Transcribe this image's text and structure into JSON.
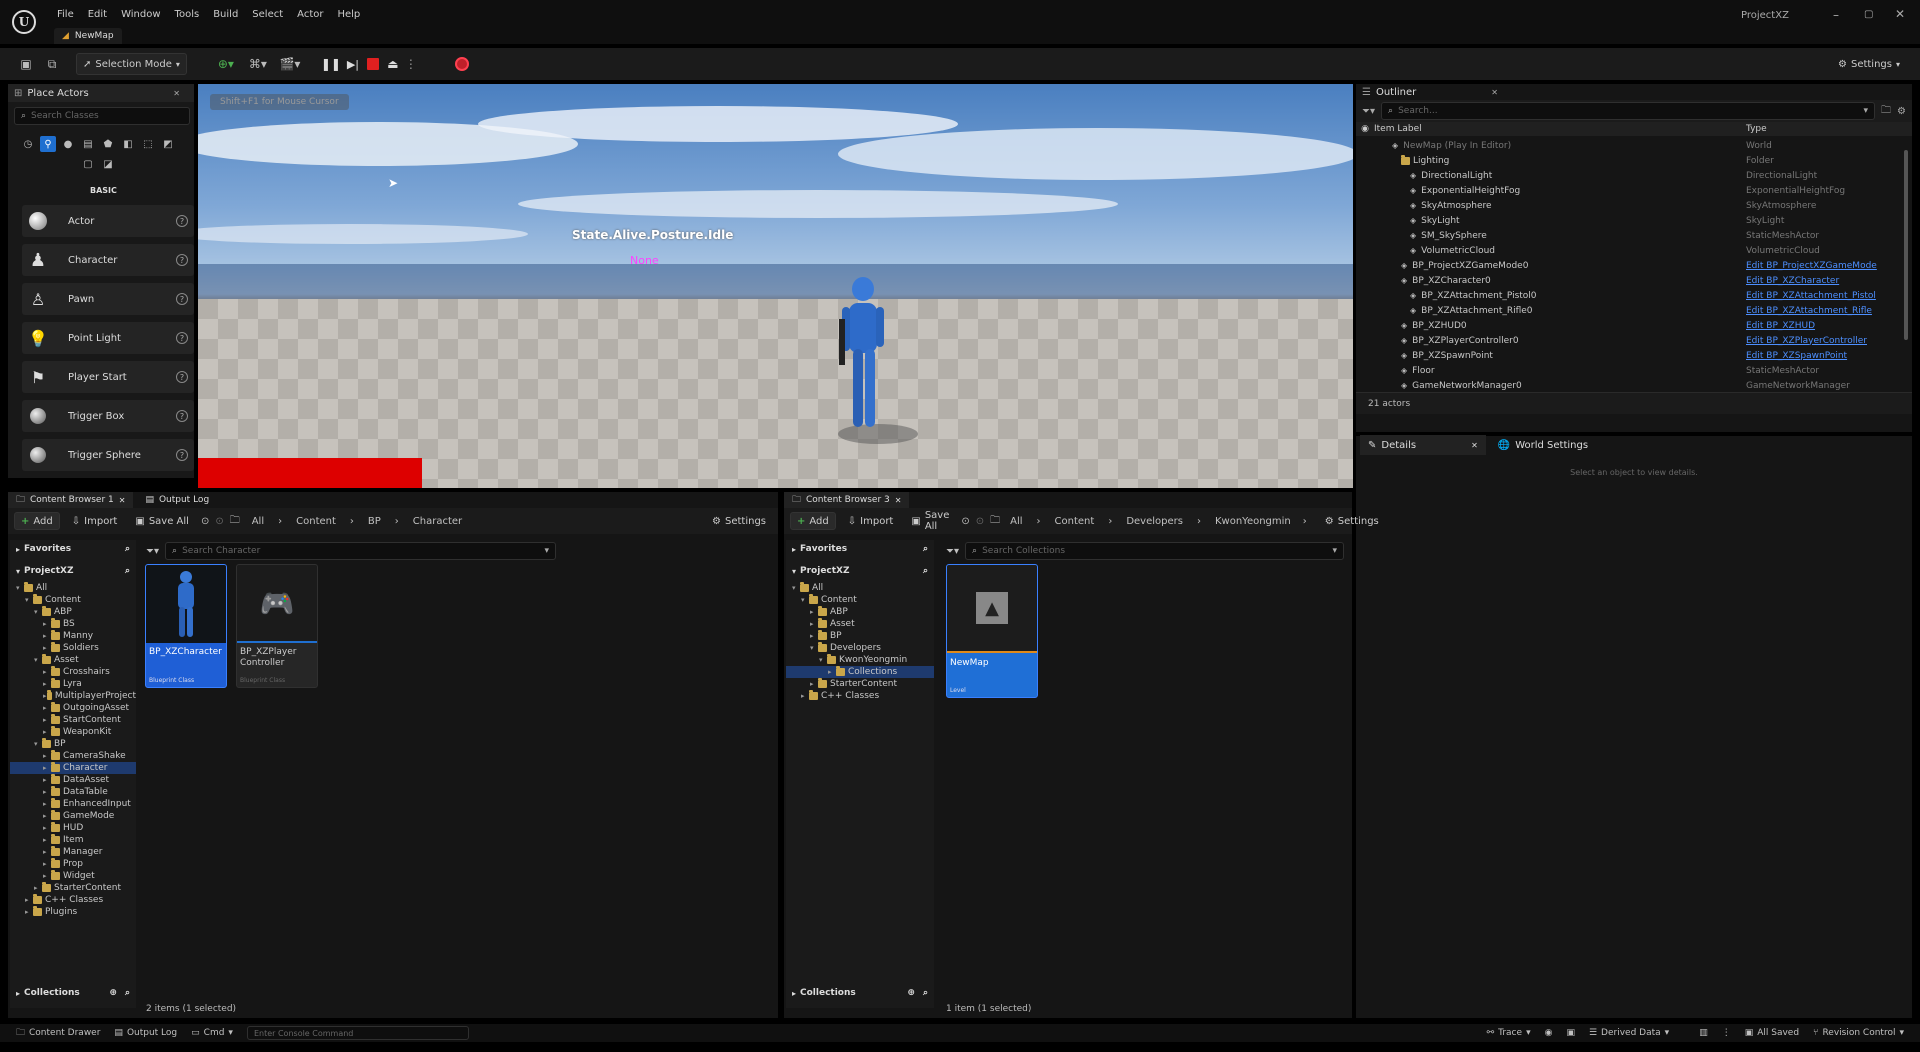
{
  "menu": {
    "items": [
      "File",
      "Edit",
      "Window",
      "Tools",
      "Build",
      "Select",
      "Actor",
      "Help"
    ],
    "project_name": "ProjectXZ",
    "map_tab": "NewMap"
  },
  "toolbar": {
    "selection_mode": "Selection Mode",
    "settings": "Settings"
  },
  "place_actors": {
    "title": "Place Actors",
    "search_placeholder": "Search Classes",
    "section": "BASIC",
    "items": [
      "Actor",
      "Character",
      "Pawn",
      "Point Light",
      "Player Start",
      "Trigger Box",
      "Trigger Sphere"
    ]
  },
  "viewport": {
    "banner": "Shift+F1 for Mouse Cursor",
    "state_text": "State.Alive.Posture.Idle",
    "none_text": "None",
    "colors": {
      "state": "#ffffff",
      "none": "#ff40ff",
      "health_bar": "#dd0000"
    }
  },
  "outliner": {
    "title": "Outliner",
    "search_placeholder": "Search...",
    "col_label": "Item Label",
    "col_type": "Type",
    "rows": [
      {
        "label": "NewMap (Play In Editor)",
        "type": "World",
        "indent": 2,
        "dim": true,
        "link": false
      },
      {
        "label": "Lighting",
        "type": "Folder",
        "indent": 3,
        "dim": false,
        "link": false
      },
      {
        "label": "DirectionalLight",
        "type": "DirectionalLight",
        "indent": 4,
        "dim": false,
        "link": false
      },
      {
        "label": "ExponentialHeightFog",
        "type": "ExponentialHeightFog",
        "indent": 4,
        "dim": false,
        "link": false
      },
      {
        "label": "SkyAtmosphere",
        "type": "SkyAtmosphere",
        "indent": 4,
        "dim": false,
        "link": false
      },
      {
        "label": "SkyLight",
        "type": "SkyLight",
        "indent": 4,
        "dim": false,
        "link": false
      },
      {
        "label": "SM_SkySphere",
        "type": "StaticMeshActor",
        "indent": 4,
        "dim": false,
        "link": false
      },
      {
        "label": "VolumetricCloud",
        "type": "VolumetricCloud",
        "indent": 4,
        "dim": false,
        "link": false
      },
      {
        "label": "BP_ProjectXZGameMode0",
        "type": "Edit BP_ProjectXZGameMode",
        "indent": 3,
        "dim": false,
        "link": true
      },
      {
        "label": "BP_XZCharacter0",
        "type": "Edit BP_XZCharacter",
        "indent": 3,
        "dim": false,
        "link": true
      },
      {
        "label": "BP_XZAttachment_Pistol0",
        "type": "Edit BP_XZAttachment_Pistol",
        "indent": 4,
        "dim": false,
        "link": true
      },
      {
        "label": "BP_XZAttachment_Rifle0",
        "type": "Edit BP_XZAttachment_Rifle",
        "indent": 4,
        "dim": false,
        "link": true
      },
      {
        "label": "BP_XZHUD0",
        "type": "Edit BP_XZHUD",
        "indent": 3,
        "dim": false,
        "link": true
      },
      {
        "label": "BP_XZPlayerController0",
        "type": "Edit BP_XZPlayerController",
        "indent": 3,
        "dim": false,
        "link": true
      },
      {
        "label": "BP_XZSpawnPoint",
        "type": "Edit BP_XZSpawnPoint",
        "indent": 3,
        "dim": false,
        "link": true
      },
      {
        "label": "Floor",
        "type": "StaticMeshActor",
        "indent": 3,
        "dim": false,
        "link": false
      },
      {
        "label": "GameNetworkManager0",
        "type": "GameNetworkManager",
        "indent": 3,
        "dim": false,
        "link": false
      }
    ],
    "count": "21 actors"
  },
  "details": {
    "tab1": "Details",
    "tab2": "World Settings",
    "empty": "Select an object to view details."
  },
  "cb1": {
    "tab": "Content Browser 1",
    "tab_log": "Output Log",
    "add": "Add",
    "import": "Import",
    "save_all": "Save All",
    "settings": "Settings",
    "crumbs": [
      "All",
      "Content",
      "BP",
      "Character"
    ],
    "favorites": "Favorites",
    "project": "ProjectXZ",
    "search_placeholder": "Search Character",
    "tree": [
      {
        "label": "All",
        "indent": 0,
        "open": true,
        "sel": false
      },
      {
        "label": "Content",
        "indent": 1,
        "open": true,
        "sel": false
      },
      {
        "label": "ABP",
        "indent": 2,
        "open": true,
        "sel": false
      },
      {
        "label": "BS",
        "indent": 3,
        "open": false,
        "sel": false
      },
      {
        "label": "Manny",
        "indent": 3,
        "open": false,
        "sel": false
      },
      {
        "label": "Soldiers",
        "indent": 3,
        "open": false,
        "sel": false
      },
      {
        "label": "Asset",
        "indent": 2,
        "open": true,
        "sel": false
      },
      {
        "label": "Crosshairs",
        "indent": 3,
        "open": false,
        "sel": false
      },
      {
        "label": "Lyra",
        "indent": 3,
        "open": false,
        "sel": false
      },
      {
        "label": "MultiplayerProject",
        "indent": 3,
        "open": false,
        "sel": false
      },
      {
        "label": "OutgoingAsset",
        "indent": 3,
        "open": false,
        "sel": false
      },
      {
        "label": "StartContent",
        "indent": 3,
        "open": false,
        "sel": false
      },
      {
        "label": "WeaponKit",
        "indent": 3,
        "open": false,
        "sel": false
      },
      {
        "label": "BP",
        "indent": 2,
        "open": true,
        "sel": false
      },
      {
        "label": "CameraShake",
        "indent": 3,
        "open": false,
        "sel": false
      },
      {
        "label": "Character",
        "indent": 3,
        "open": false,
        "sel": true
      },
      {
        "label": "DataAsset",
        "indent": 3,
        "open": false,
        "sel": false
      },
      {
        "label": "DataTable",
        "indent": 3,
        "open": false,
        "sel": false
      },
      {
        "label": "EnhancedInput",
        "indent": 3,
        "open": false,
        "sel": false
      },
      {
        "label": "GameMode",
        "indent": 3,
        "open": false,
        "sel": false
      },
      {
        "label": "HUD",
        "indent": 3,
        "open": false,
        "sel": false
      },
      {
        "label": "Item",
        "indent": 3,
        "open": false,
        "sel": false
      },
      {
        "label": "Manager",
        "indent": 3,
        "open": false,
        "sel": false
      },
      {
        "label": "Prop",
        "indent": 3,
        "open": false,
        "sel": false
      },
      {
        "label": "Widget",
        "indent": 3,
        "open": false,
        "sel": false
      },
      {
        "label": "StarterContent",
        "indent": 2,
        "open": false,
        "sel": false
      },
      {
        "label": "C++ Classes",
        "indent": 1,
        "open": false,
        "sel": false
      },
      {
        "label": "Plugins",
        "indent": 1,
        "open": false,
        "sel": false
      }
    ],
    "assets": [
      {
        "name": "BP_XZCharacter",
        "type": "Blueprint Class"
      },
      {
        "name": "BP_XZPlayer Controller",
        "type": "Blueprint Class"
      }
    ],
    "collections": "Collections",
    "status": "2 items (1 selected)"
  },
  "cb3": {
    "tab": "Content Browser 3",
    "add": "Add",
    "import": "Import",
    "save_all": "Save All",
    "settings": "Settings",
    "crumbs": [
      "All",
      "Content",
      "Developers",
      "KwonYeongmin"
    ],
    "favorites": "Favorites",
    "project": "ProjectXZ",
    "search_placeholder": "Search Collections",
    "tree": [
      {
        "label": "All",
        "indent": 0,
        "open": true,
        "sel": false
      },
      {
        "label": "Content",
        "indent": 1,
        "open": true,
        "sel": false
      },
      {
        "label": "ABP",
        "indent": 2,
        "open": false,
        "sel": false
      },
      {
        "label": "Asset",
        "indent": 2,
        "open": false,
        "sel": false
      },
      {
        "label": "BP",
        "indent": 2,
        "open": false,
        "sel": false
      },
      {
        "label": "Developers",
        "indent": 2,
        "open": true,
        "sel": false
      },
      {
        "label": "KwonYeongmin",
        "indent": 3,
        "open": true,
        "sel": false
      },
      {
        "label": "Collections",
        "indent": 4,
        "open": false,
        "sel": true
      },
      {
        "label": "StarterContent",
        "indent": 2,
        "open": false,
        "sel": false
      },
      {
        "label": "C++ Classes",
        "indent": 1,
        "open": false,
        "sel": false
      }
    ],
    "assets": [
      {
        "name": "NewMap",
        "type": "Level"
      }
    ],
    "collections": "Collections",
    "status": "1 item (1 selected)"
  },
  "statusbar": {
    "drawer": "Content Drawer",
    "output_log": "Output Log",
    "cmd": "Cmd",
    "console_placeholder": "Enter Console Command",
    "trace": "Trace",
    "derived": "Derived Data",
    "saved": "All Saved",
    "revision": "Revision Control"
  }
}
